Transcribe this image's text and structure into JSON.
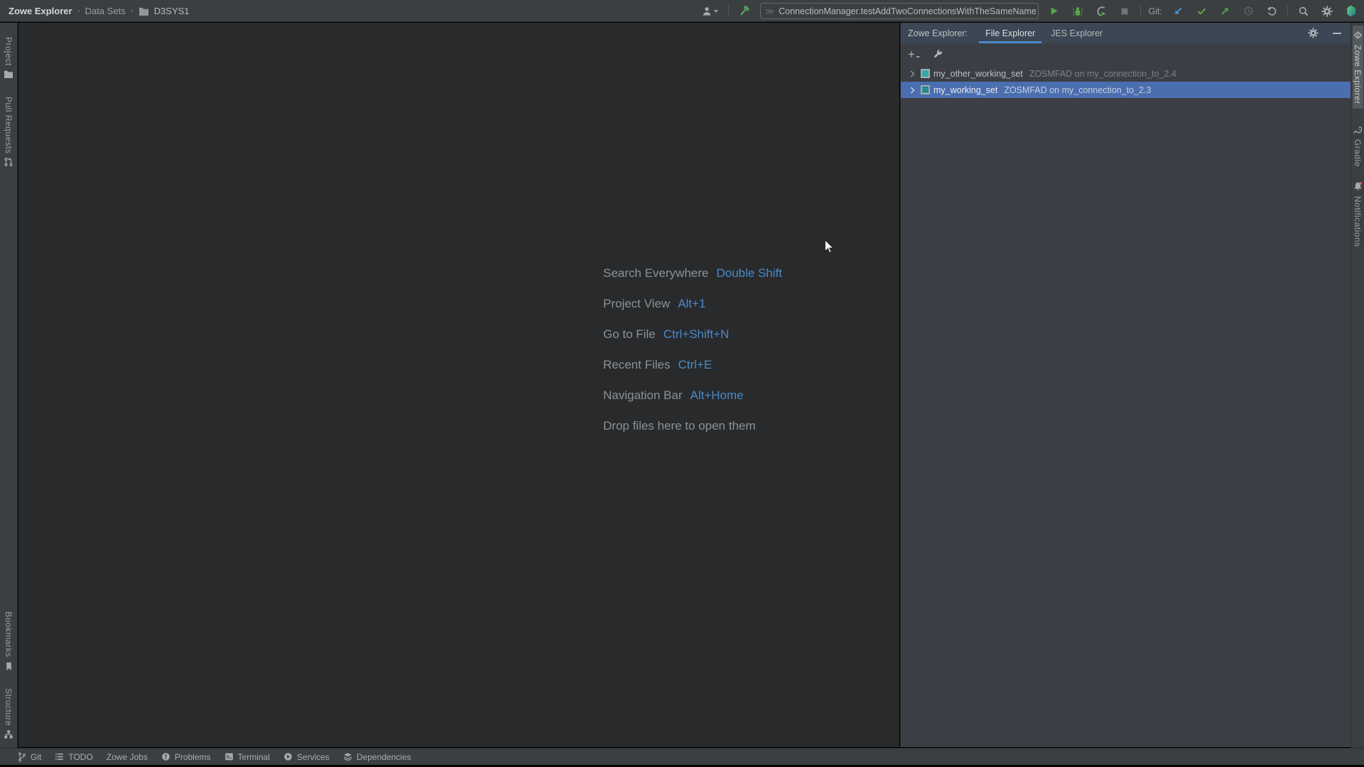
{
  "topbar": {
    "breadcrumb": [
      "Zowe Explorer",
      "Data Sets",
      "D3SYS1"
    ],
    "separator": "›",
    "run_config": "ConnectionManager.testAddTwoConnectionsWithTheSameName",
    "git_label": "Git:"
  },
  "left_stripe": {
    "project": "Project",
    "pull_requests": "Pull Requests",
    "bookmarks": "Bookmarks",
    "structure": "Structure"
  },
  "right_stripe": {
    "zowe": "Zowe Explorer",
    "gradle": "Gradle",
    "notifications": "Notifications"
  },
  "panel": {
    "title": "Zowe Explorer:",
    "tabs": {
      "file": "File Explorer",
      "jes": "JES Explorer"
    },
    "tree": {
      "row1": {
        "name": "my_other_working_set",
        "detail": "ZOSMFAD on my_connection_to_2.4"
      },
      "row2": {
        "name": "my_working_set",
        "detail": "ZOSMFAD on my_connection_to_2.3"
      }
    }
  },
  "editor": {
    "shortcuts": [
      {
        "label": "Search Everywhere",
        "key": "Double Shift"
      },
      {
        "label": "Project View",
        "key": "Alt+1"
      },
      {
        "label": "Go to File",
        "key": "Ctrl+Shift+N"
      },
      {
        "label": "Recent Files",
        "key": "Ctrl+E"
      },
      {
        "label": "Navigation Bar",
        "key": "Alt+Home"
      },
      {
        "label": "Drop files here to open them",
        "key": ""
      }
    ]
  },
  "bottom_bar": {
    "git": "Git",
    "todo": "TODO",
    "zowe_jobs": "Zowe Jobs",
    "problems": "Problems",
    "terminal": "Terminal",
    "services": "Services",
    "dependencies": "Dependencies"
  },
  "colors": {
    "accent_blue": "#4a88c8",
    "selection_blue": "#4b6eaf",
    "run_green": "#57a64a",
    "update_blue": "#4a9bd6",
    "header_bg": "#3b4754",
    "editor_bg": "#282a2c",
    "panel_bg": "#3b3e44"
  }
}
